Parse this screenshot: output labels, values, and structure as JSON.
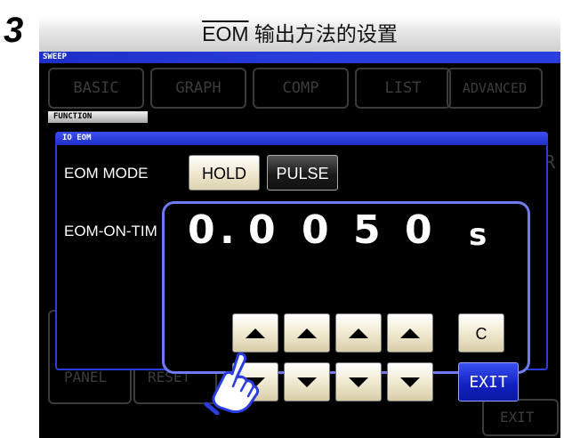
{
  "step_number": "3",
  "title": {
    "overlined": "EOM",
    "rest": " 输出方法的设置"
  },
  "screen": {
    "sweep_label": "SWEEP",
    "tabs": [
      "BASIC",
      "GRAPH",
      "COMP",
      "LIST",
      "ADVANCED"
    ],
    "function_label": "FUNCTION",
    "background_buttons": {
      "panel": "PANEL",
      "reset": "RESET",
      "exit": "EXIT",
      "right_fragment": "R"
    }
  },
  "dialog": {
    "title": "IO EOM",
    "mode_label": "EOM MODE",
    "mode_options": [
      "HOLD",
      "PULSE"
    ],
    "mode_selected": "PULSE",
    "on_time_label": "EOM-ON-TIM",
    "value_digits": [
      "0",
      ".",
      "0",
      "0",
      "5",
      "0",
      "s"
    ],
    "clear_label": "C",
    "exit_label": "EXIT"
  },
  "icons": {
    "up": "arrow-up-icon",
    "down": "arrow-down-icon",
    "hand": "pointing-hand-icon"
  },
  "colors": {
    "accent_blue": "#2a3ee0",
    "button_cream": "#efe7cd",
    "pad_border": "#6f7af0"
  }
}
